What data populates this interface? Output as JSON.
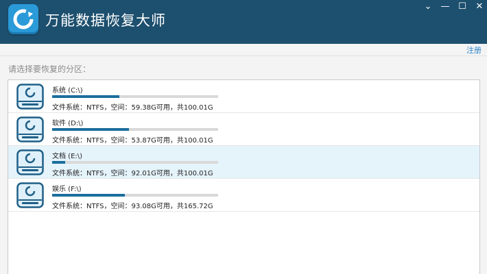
{
  "window": {
    "title": "万能数据恢复大师",
    "controls": {
      "chevron": "⌄",
      "minimize": "—",
      "maximize": "☐",
      "close": "✕"
    }
  },
  "header": {
    "register_label": "注册"
  },
  "prompt": "请选择要恢复的分区：",
  "colors": {
    "titlebar": "#1d4f6e",
    "accent": "#1a6e9c",
    "selected_row": "#e5f3fb",
    "link": "#2b83c7"
  },
  "partitions": [
    {
      "name": "系统 (C:\\)",
      "info": "文件系统：NTFS，空间：59.38G可用，共100.01G",
      "used_fraction": 0.406
    },
    {
      "name": "软件 (D:\\)",
      "info": "文件系统：NTFS，空间：53.87G可用，共100.01G",
      "used_fraction": 0.461
    },
    {
      "name": "文档 (E:\\)",
      "info": "文件系统：NTFS，空间：92.01G可用，共100.01G",
      "used_fraction": 0.08,
      "selected": true
    },
    {
      "name": "娱乐 (F:\\)",
      "info": "文件系统：NTFS，空间：93.08G可用，共165.72G",
      "used_fraction": 0.438
    }
  ]
}
